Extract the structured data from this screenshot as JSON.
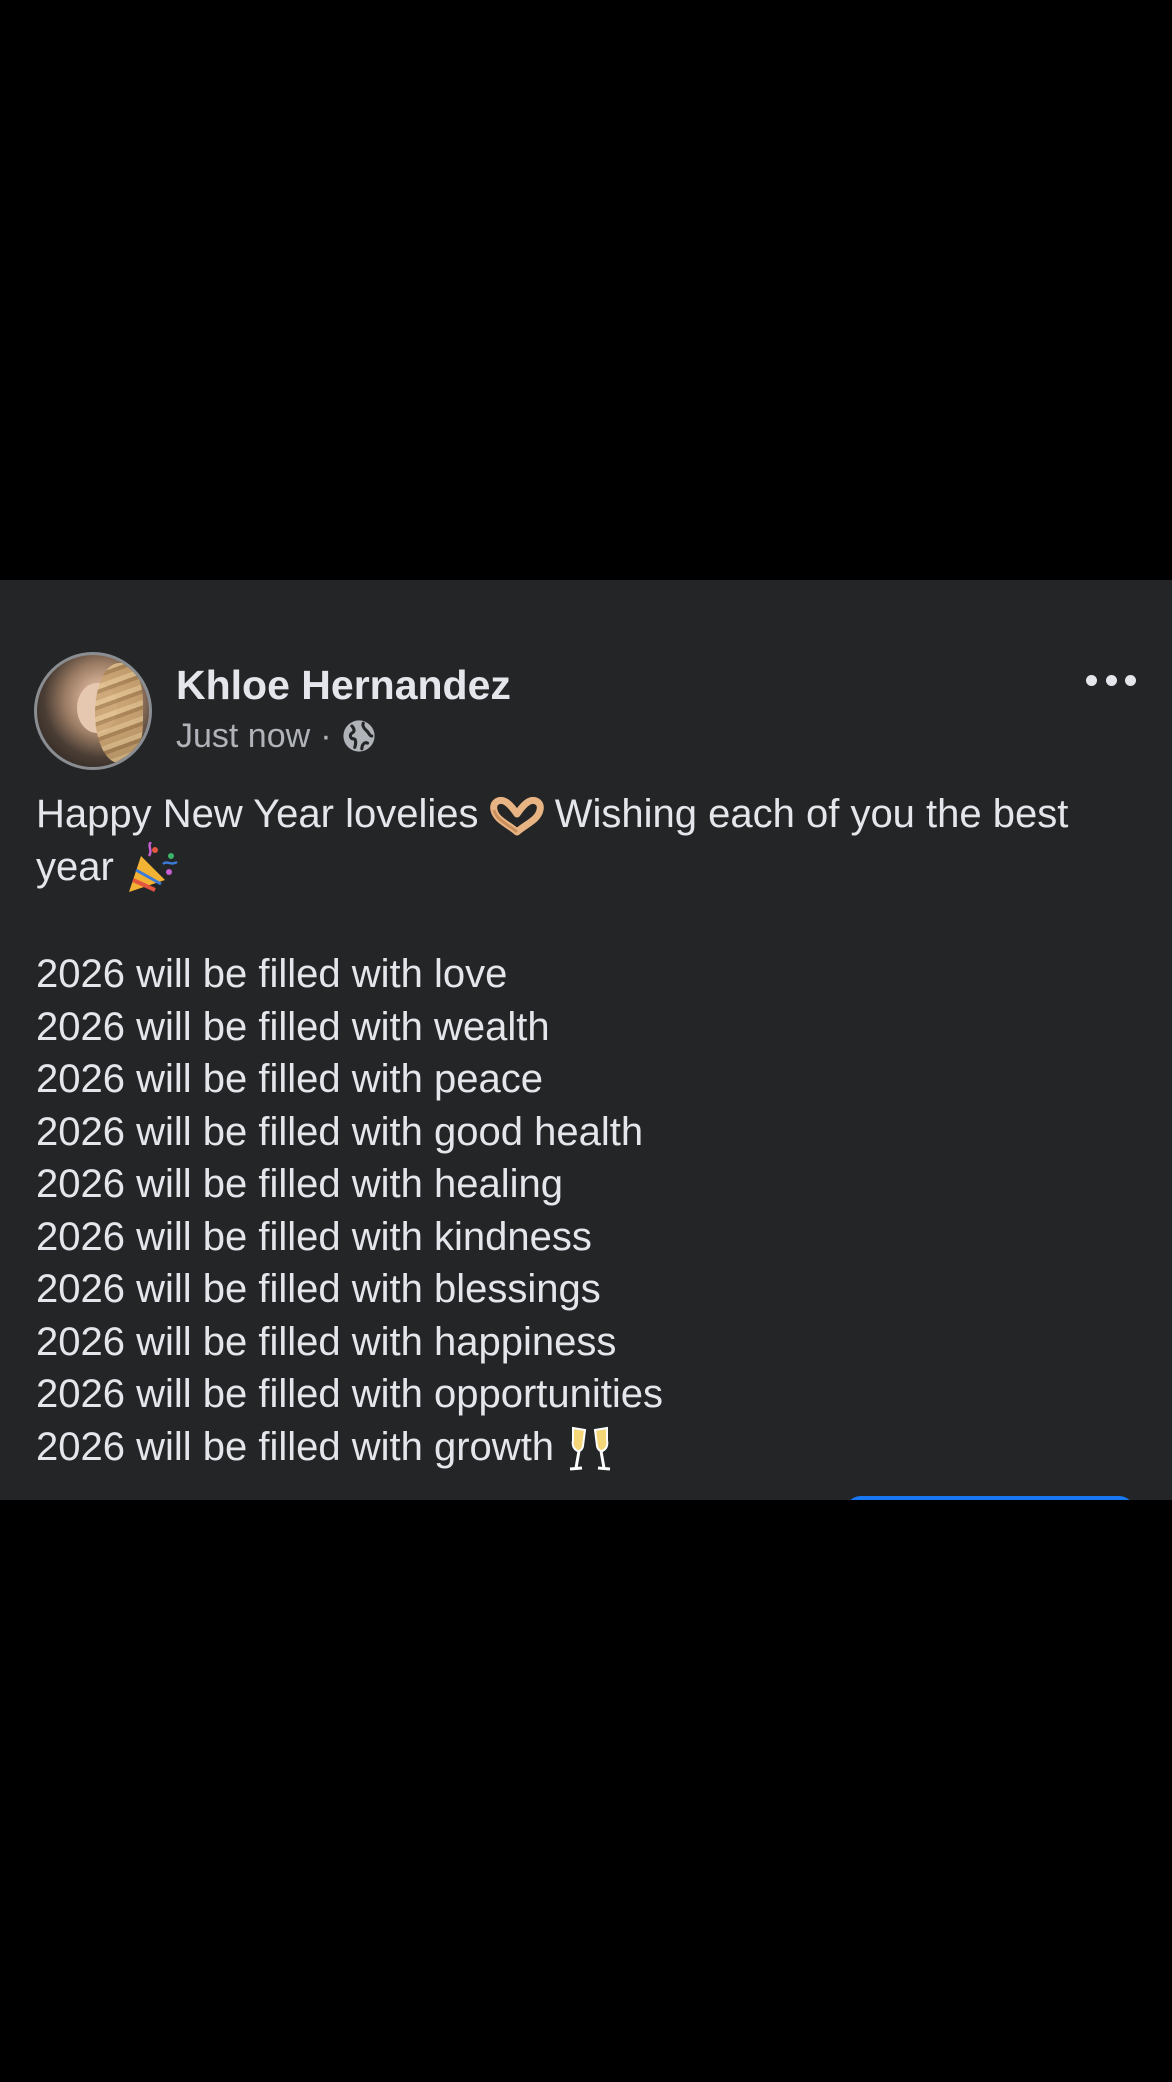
{
  "post": {
    "author": "Khloe Hernandez",
    "timestamp": "Just now",
    "separator": "·",
    "privacy_icon": "globe-icon",
    "more_icon": "more-options-icon",
    "intro_part1": "Happy New Year lovelies",
    "intro_part2": "Wishing each of you the best year",
    "intro_emoji_1": "heart-hands-emoji",
    "intro_emoji_2": "party-popper-emoji",
    "lines": [
      "2026 will be filled with love",
      "2026 will be filled with wealth",
      "2026 will be filled with peace",
      "2026 will be filled with good health",
      "2026 will be filled with healing",
      "2026 will be filled with kindness",
      "2026 will be filled with blessings",
      "2026 will be filled with happiness",
      "2026 will be filled with opportunities",
      "2026 will be filled with growth"
    ],
    "last_line_emoji": "clinking-glasses-emoji"
  },
  "colors": {
    "background": "#000000",
    "card": "#242526",
    "primary_text": "#e4e6eb",
    "secondary_text": "#b0b3b8",
    "accent": "#1877f2"
  }
}
